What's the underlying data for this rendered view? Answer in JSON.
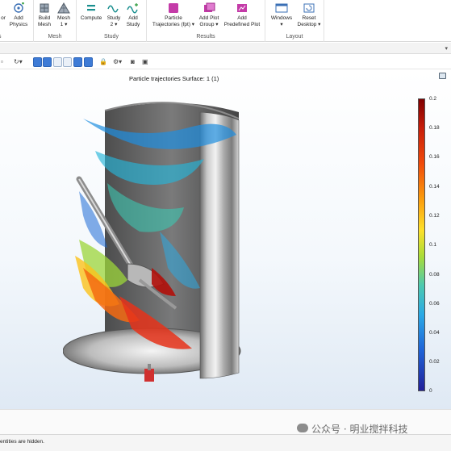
{
  "ribbon": {
    "groups": [
      {
        "label": "Mesh",
        "buttons": [
          "Build Mesh",
          "Mesh 1"
        ]
      },
      {
        "label": "Study",
        "buttons": [
          "Compute",
          "Study 2",
          "Add Study"
        ]
      },
      {
        "label": "Results",
        "buttons": [
          "Particle Trajectories (fpt)",
          "Add Plot Group",
          "Add Predefined Plot"
        ]
      },
      {
        "label": "Layout",
        "buttons": [
          "Windows",
          "Reset Desktop"
        ]
      }
    ],
    "partial_left": {
      "top": "or",
      "label": "s"
    },
    "add_physics": "Add Physics",
    "build_mesh_1": "Build",
    "build_mesh_2": "Mesh",
    "mesh1_1": "Mesh",
    "mesh1_2": "1 ▾",
    "compute": "Compute",
    "study2_1": "Study",
    "study2_2": "2 ▾",
    "add_study_1": "Add",
    "add_study_2": "Study",
    "pt_1": "Particle",
    "pt_2": "Trajectories (fpt) ▾",
    "apg_1": "Add Plot",
    "apg_2": "Group ▾",
    "app_1": "Add",
    "app_2": "Predefined Plot",
    "windows_1": "Windows",
    "windows_2": "▾",
    "reset_1": "Reset",
    "reset_2": "Desktop ▾",
    "group_mesh": "Mesh",
    "group_study": "Study",
    "group_results": "Results",
    "group_layout": "Layout"
  },
  "graphics": {
    "plot_title": "Particle trajectories  Surface: 1 (1)"
  },
  "colorbar": {
    "ticks": [
      "0.2",
      "0.18",
      "0.16",
      "0.14",
      "0.12",
      "0.1",
      "0.08",
      "0.06",
      "0.04",
      "0.02",
      "0"
    ],
    "colors": {
      "max": "#800000",
      "mid": "#fde02a",
      "min": "#22209a"
    }
  },
  "status": {
    "text": "entities are hidden."
  },
  "watermark": {
    "text": "公众号 · 明业搅拌科技"
  }
}
